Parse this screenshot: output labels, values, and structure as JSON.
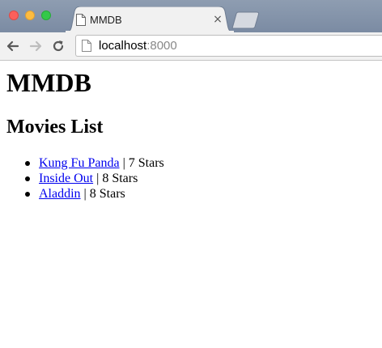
{
  "browser": {
    "tab": {
      "title": "MMDB",
      "close_glyph": "×",
      "icon": "document-icon"
    },
    "toolbar": {
      "back_icon": "back-arrow-icon",
      "forward_icon": "forward-arrow-icon",
      "reload_icon": "reload-icon"
    },
    "address": {
      "host": "localhost",
      "port": ":8000",
      "icon": "page-icon"
    },
    "colors": {
      "close": "#fc605c",
      "minimize": "#fdbc40",
      "zoom": "#34c84a",
      "link": "#0000ee"
    }
  },
  "page": {
    "title": "MMDB",
    "subtitle": "Movies List",
    "movies": [
      {
        "name": "Kung Fu Panda",
        "rating": "7 Stars"
      },
      {
        "name": "Inside Out",
        "rating": "8 Stars"
      },
      {
        "name": "Aladdin",
        "rating": "8 Stars"
      }
    ],
    "separator": " | "
  }
}
